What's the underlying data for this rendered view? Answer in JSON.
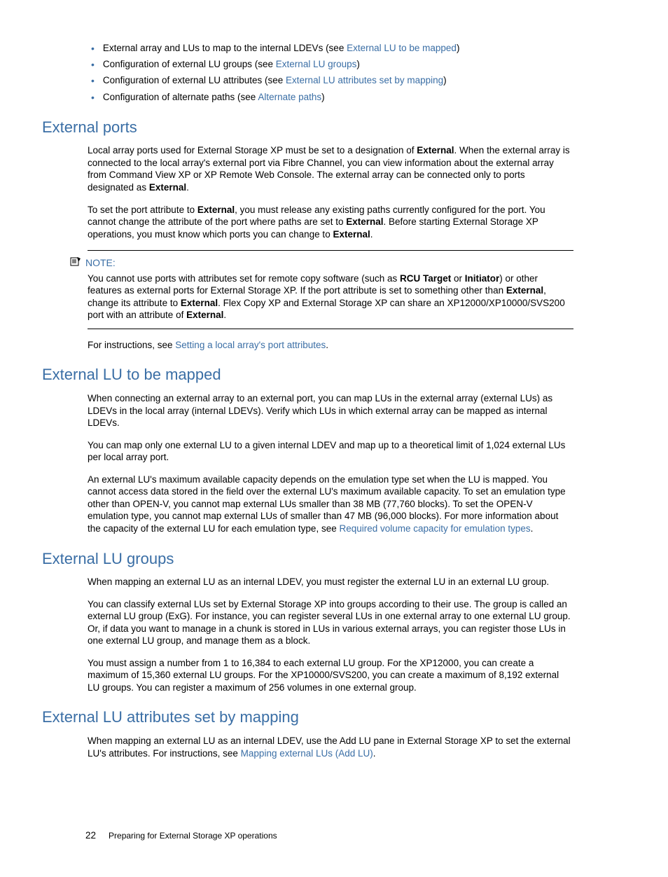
{
  "bullets": [
    {
      "pre": "External array and LUs to map to the internal LDEVs (see ",
      "link": "External LU to be mapped",
      "post": ")"
    },
    {
      "pre": "Configuration of external LU groups (see ",
      "link": "External LU groups",
      "post": ")"
    },
    {
      "pre": "Configuration of external LU attributes (see ",
      "link": "External LU attributes set by mapping",
      "post": ")"
    },
    {
      "pre": "Configuration of alternate paths (see ",
      "link": "Alternate paths",
      "post": ")"
    }
  ],
  "section1": {
    "heading": "External ports",
    "p1a": "Local array ports used for External Storage XP must be set to a designation of ",
    "p1b": "External",
    "p1c": ". When the external array is connected to the local array's external port via Fibre Channel, you can view information about the external array from Command View XP or XP Remote Web Console. The external array can be connected only to ports designated as ",
    "p1d": "External",
    "p1e": ".",
    "p2a": "To set the port attribute to ",
    "p2b": "External",
    "p2c": ", you must release any existing paths currently configured for the port. You cannot change the attribute of the port where paths are set to ",
    "p2d": "External",
    "p2e": ". Before starting External Storage XP operations, you must know which ports you can change to ",
    "p2f": "External",
    "p2g": ".",
    "note_label": "NOTE:",
    "n1": "You cannot use ports with attributes set for remote copy software (such as ",
    "n2": "RCU Target",
    "n3": " or ",
    "n4": "Initiator",
    "n5": ") or other features as external ports for External Storage XP. If the port attribute is set to something other than ",
    "n6": "External",
    "n7": ", change its attribute to ",
    "n8": "External",
    "n9": ". Flex Copy XP and External Storage XP can share an XP12000/XP10000/SVS200 port with an attribute of ",
    "n10": "External",
    "n11": ".",
    "p3a": "For instructions, see ",
    "p3_link": "Setting a local array's port attributes",
    "p3b": "."
  },
  "section2": {
    "heading": "External LU to be mapped",
    "p1": "When connecting an external array to an external port, you can map LUs in the external array (external LUs) as LDEVs in the local array (internal LDEVs). Verify which LUs in which external array can be mapped as internal LDEVs.",
    "p2": "You can map only one external LU to a given internal LDEV and map up to a theoretical limit of 1,024 external LUs per local array port.",
    "p3a": "An external LU's maximum available capacity depends on the emulation type set when the LU is mapped. You cannot access data stored in the field over the external LU's maximum available capacity. To set an emulation type other than OPEN-V, you cannot map external LUs smaller than 38 MB (77,760 blocks). To set the OPEN-V emulation type, you cannot map external LUs of smaller than 47 MB (96,000 blocks). For more information about the capacity of the external LU for each emulation type, see ",
    "p3_link": "Required volume capacity for emulation types",
    "p3b": "."
  },
  "section3": {
    "heading": "External LU groups",
    "p1": "When mapping an external LU as an internal LDEV, you must register the external LU in an external LU group.",
    "p2": "You can classify external LUs set by External Storage XP into groups according to their use. The group is called an external LU group (ExG). For instance, you can register several LUs in one external array to one external LU group. Or, if data you want to manage in a chunk is stored in LUs in various external arrays, you can register those LUs in one external LU group, and manage them as a block.",
    "p3": "You must assign a number from 1 to 16,384 to each external LU group. For the XP12000, you can create a maximum of 15,360 external LU groups. For the XP10000/SVS200, you can create a maximum of 8,192 external LU groups. You can register a maximum of 256 volumes in one external group."
  },
  "section4": {
    "heading": "External LU attributes set by mapping",
    "p1a": "When mapping an external LU as an internal LDEV, use the Add LU pane in External Storage XP to set the external LU's attributes. For instructions, see ",
    "p1_link": "Mapping external LUs (Add LU)",
    "p1b": "."
  },
  "footer": {
    "page": "22",
    "title": "Preparing for External Storage XP operations"
  }
}
